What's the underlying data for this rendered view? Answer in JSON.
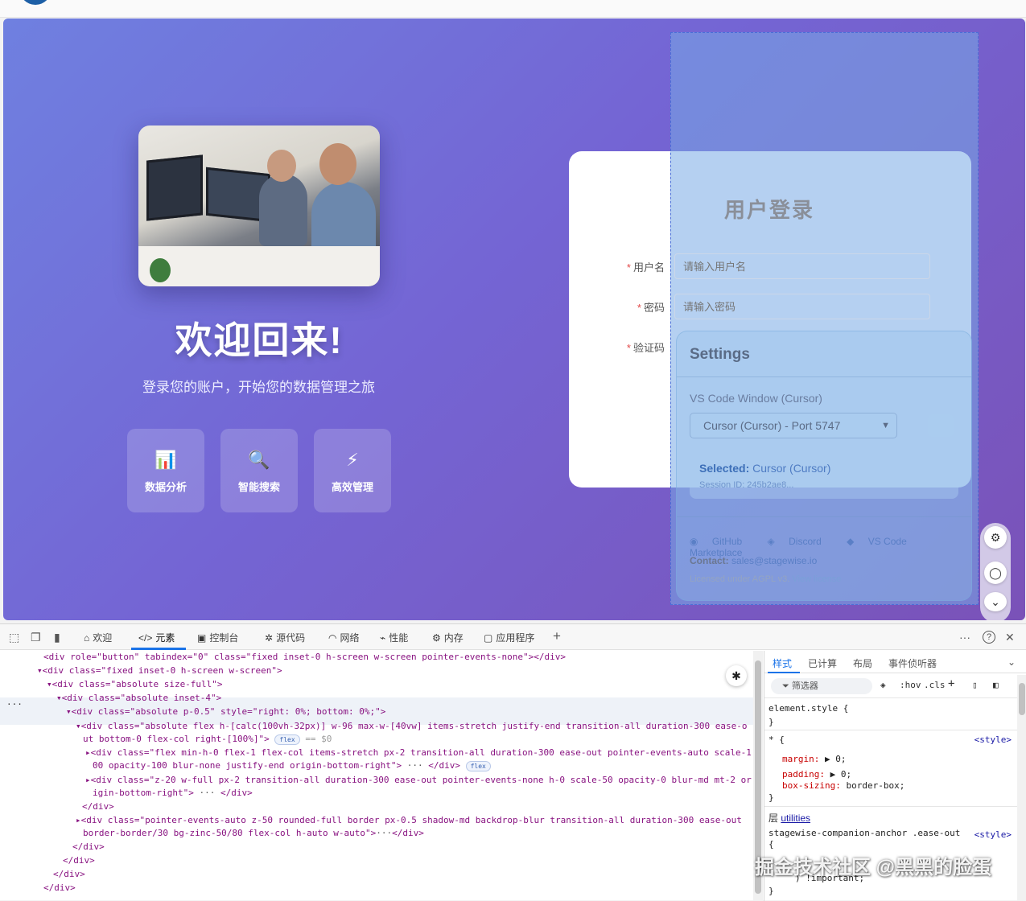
{
  "page": {
    "welcome_title": "欢迎回来!",
    "welcome_subtitle": "登录您的账户，开始您的数据管理之旅",
    "features": [
      {
        "icon": "bar-chart-icon",
        "glyph": "📊",
        "label": "数据分析"
      },
      {
        "icon": "magnifier-icon",
        "glyph": "🔍",
        "label": "智能搜索"
      },
      {
        "icon": "lightning-icon",
        "glyph": "⚡",
        "label": "高效管理"
      }
    ],
    "login": {
      "title": "用户登录",
      "required_mark": "*",
      "username_label": "用户名",
      "username_placeholder": "请输入用户名",
      "password_label": "密码",
      "password_placeholder": "请输入密码",
      "captcha_label": "验证码"
    }
  },
  "stagewise": {
    "title": "Settings",
    "window_label": "VS Code Window (Cursor)",
    "select_value": "Cursor (Cursor) - Port 5747",
    "selected_label": "Selected:",
    "selected_value": "Cursor (Cursor)",
    "session": "Session ID: 245b2ae8...",
    "links": [
      "GitHub",
      "Discord",
      "VS Code Marketplace"
    ],
    "contact_label": "Contact:",
    "contact_email": "sales@stagewise.io",
    "license_text": "Licensed under AGPL v3.",
    "license_link": "View license"
  },
  "devtools": {
    "tabs": [
      {
        "icon": "home-icon",
        "glyph": "⌂",
        "label": "欢迎"
      },
      {
        "icon": "code-icon",
        "glyph": "</>",
        "label": "元素"
      },
      {
        "icon": "console-icon",
        "glyph": "▣",
        "label": "控制台"
      },
      {
        "icon": "bug-icon",
        "glyph": "✲",
        "label": "源代码"
      },
      {
        "icon": "wifi-icon",
        "glyph": "◠",
        "label": "网络"
      },
      {
        "icon": "performance-icon",
        "glyph": "⌁",
        "label": "性能"
      },
      {
        "icon": "memory-icon",
        "glyph": "⚙",
        "label": "内存"
      },
      {
        "icon": "application-icon",
        "glyph": "▢",
        "label": "应用程序"
      }
    ],
    "add_tab": "+",
    "more": "···",
    "help": "?",
    "close": "✕",
    "dom_lines": [
      "<div role=\"button\" tabindex=\"0\" class=\"fixed inset-0 h-screen w-screen pointer-events-none\"></div>",
      "▾<div class=\"fixed inset-0 h-screen w-screen\">",
      "▾<div class=\"absolute size-full\">",
      "▾<div class=\"absolute inset-4\">",
      "▾<div class=\"absolute p-0.5\" style=\"right: 0%; bottom: 0%;\">",
      "▾<div class=\"absolute flex h-[calc(100vh-32px)] w-96 max-w-[40vw] items-stretch justify-end transition-all duration-300 ease-o",
      "ut bottom-0 flex-col right-[100%]\">",
      "▸<div class=\"flex min-h-0 flex-1 flex-col items-stretch px-2 transition-all duration-300 ease-out pointer-events-auto scale-1",
      "00 opacity-100 blur-none justify-end origin-bottom-right\">",
      "▸<div class=\"z-20 w-full px-2 transition-all duration-300 ease-out pointer-events-none h-0 scale-50 opacity-0 blur-md mt-2 or",
      "igin-bottom-right\">",
      "</div>",
      "▸<div class=\"pointer-events-auto z-50 rounded-full border px-0.5 shadow-md backdrop-blur transition-all duration-300 ease-out",
      "border-border/30 bg-zinc-50/80 flex-col h-auto w-auto\">",
      "</div>",
      "</div>",
      "</div>",
      "</div>"
    ],
    "badge_flex": "flex",
    "eq_dollar": "== $0",
    "ellipsis": "···",
    "styles_tabs": [
      "样式",
      "已计算",
      "布局",
      "事件侦听器"
    ],
    "filter_placeholder": "筛选器",
    "hov": ":hov",
    "cls": ".cls",
    "element_style": "element.style {",
    "close_brace": "}",
    "universal": "* {",
    "margin": "margin:",
    "padding": "padding:",
    "box_sizing": "box-sizing:",
    "zero": "0;",
    "border_box": "border-box;",
    "style_src": "<style>",
    "layer_label": "层",
    "layer_link": "utilities",
    "anchor_selector": "stagewise-companion-anchor .ease-out",
    "open_brace": "{",
    "important": ") !important;"
  },
  "watermark": "掘金技术社区 @黑黑的脸蛋"
}
